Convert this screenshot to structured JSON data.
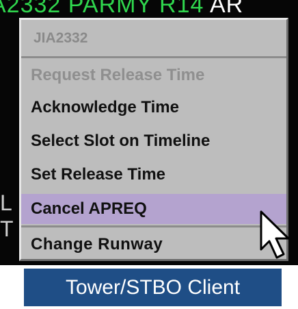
{
  "background": {
    "callsign_text": "A2332",
    "route_text": "PARMY",
    "extra_text": "R14",
    "tail_text": "AR",
    "left_glyph_1": "L",
    "left_glyph_2": "T"
  },
  "context_menu": {
    "header": "JIA2332",
    "items": [
      {
        "label": "Request Release Time",
        "state": "disabled"
      },
      {
        "label": "Acknowledge Time",
        "state": "enabled"
      },
      {
        "label": "Select Slot on Timeline",
        "state": "enabled"
      },
      {
        "label": "Set Release Time",
        "state": "enabled"
      },
      {
        "label": "Cancel APREQ",
        "state": "highlighted"
      },
      {
        "label": "Change Runway",
        "state": "enabled"
      }
    ]
  },
  "caption": {
    "text": "Tower/STBO Client"
  },
  "colors": {
    "screen_background": "#060606",
    "datablock_green": "#2fd64d",
    "menu_background": "#bdbdbd",
    "highlight": "#b4a3cf",
    "caption_background": "#1f4e86"
  }
}
